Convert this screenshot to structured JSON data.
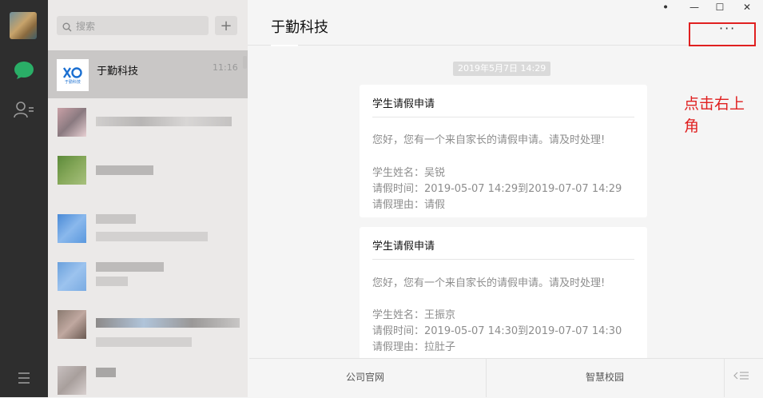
{
  "window_controls": {
    "pin": "ꔷ",
    "minimize": "—",
    "maximize": "☐",
    "close": "✕"
  },
  "search": {
    "placeholder": "搜索",
    "add": "+"
  },
  "chat_list": [
    {
      "name": "于勤科技",
      "time": "11:16",
      "logo_text": "于勤科技"
    }
  ],
  "conversation": {
    "title": "于勤科技",
    "more": "···",
    "timestamp": "2019年5月7日 14:29",
    "messages": [
      {
        "title": "学生请假申请",
        "greeting": "您好，您有一个来自家长的请假申请。请及时处理!",
        "name_line": "学生姓名：吴锐",
        "time_line": "请假时间：2019-05-07 14:29到2019-07-07 14:29",
        "reason_line": "请假理由：请假"
      },
      {
        "title": "学生请假申请",
        "greeting": "您好，您有一个来自家长的请假申请。请及时处理!",
        "name_line": "学生姓名：王振京",
        "time_line": "请假时间：2019-05-07 14:30到2019-07-07 14:30",
        "reason_line": "请假理由：拉肚子"
      }
    ]
  },
  "bottom_menu": [
    "公司官网",
    "智慧校园"
  ],
  "annotation": "点击右上角",
  "colors": {
    "accent_green": "#2aae67",
    "annotation_red": "#e02020"
  }
}
